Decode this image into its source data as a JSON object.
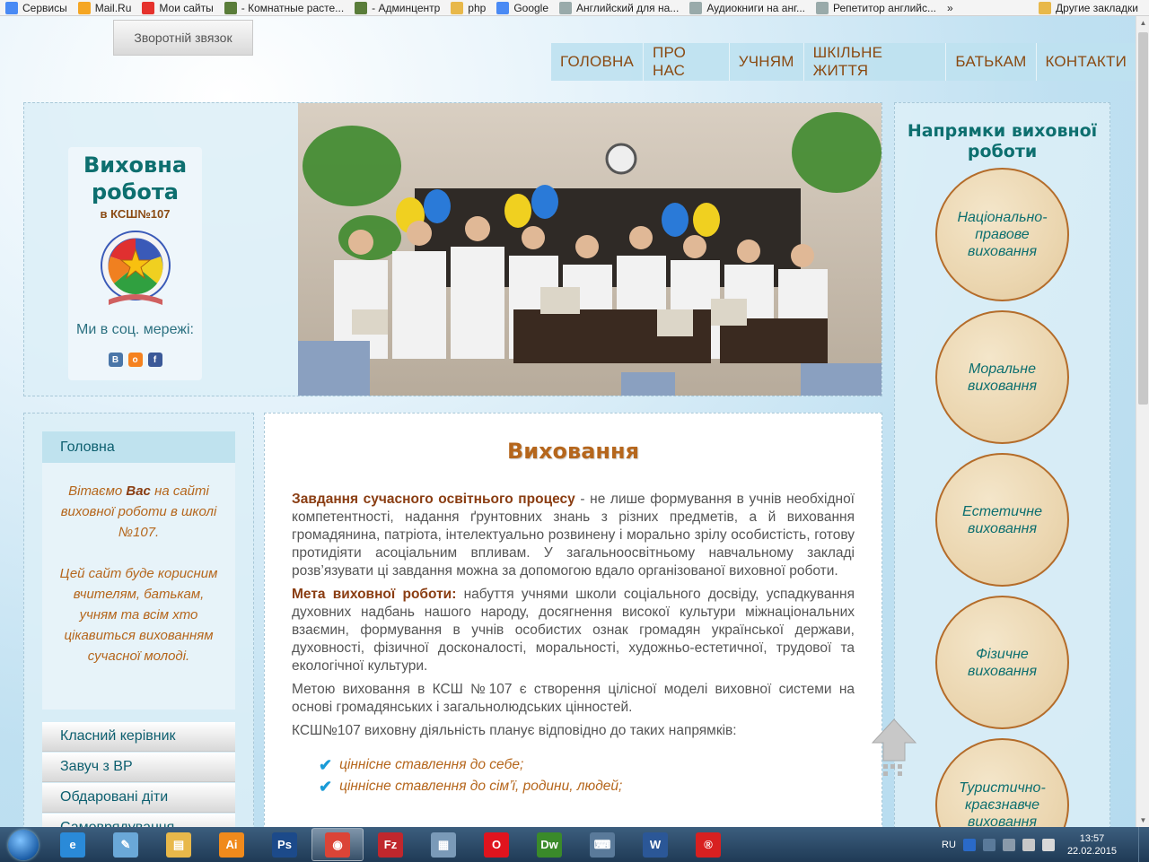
{
  "bookmarks": [
    {
      "label": "Сервисы",
      "icon": "apps-icon",
      "color": "#4a8af4"
    },
    {
      "label": "Mail.Ru",
      "icon": "mailru-icon",
      "color": "#f5a623"
    },
    {
      "label": "Мои сайты",
      "icon": "ua-icon",
      "color": "#e5322d"
    },
    {
      "label": "- Комнатные расте...",
      "icon": "plant-icon",
      "color": "#5a7d3a"
    },
    {
      "label": "- Админцентр",
      "icon": "plant-icon",
      "color": "#5a7d3a"
    },
    {
      "label": "php",
      "icon": "folder-icon",
      "color": "#e8b84a"
    },
    {
      "label": "Google",
      "icon": "google-icon",
      "color": "#4a8af4"
    },
    {
      "label": "Английский для на...",
      "icon": "page-icon",
      "color": "#9aa"
    },
    {
      "label": "Аудиокниги на анг...",
      "icon": "page-icon",
      "color": "#9aa"
    },
    {
      "label": "Репетитор английс...",
      "icon": "page-icon",
      "color": "#9aa"
    }
  ],
  "bookmarks_more": "»",
  "bookmarks_other": "Другие закладки",
  "feedback_label": "Зворотній звязок",
  "nav": [
    "ГОЛОВНА",
    "ПРО НАС",
    "УЧНЯМ",
    "ШКІЛЬНЕ ЖИТТЯ",
    "БАТЬКАМ",
    "КОНТАКТИ"
  ],
  "logo": {
    "title": "Виховна робота",
    "subtitle": "в КСШ№107",
    "social_label": "Ми в соц. мережі:",
    "social": [
      {
        "name": "vk-icon",
        "glyph": "В",
        "color": "#4a76a8"
      },
      {
        "name": "odnoklassniki-icon",
        "glyph": "о",
        "color": "#f5821f"
      },
      {
        "name": "facebook-icon",
        "glyph": "f",
        "color": "#3b5998"
      }
    ]
  },
  "right": {
    "title": "Напрямки виховної роботи",
    "circles": [
      "Національно-правове виховання",
      "Моральне виховання",
      "Естетичне виховання",
      "Фізичне виховання",
      "Туристично-краєзнавче виховання"
    ]
  },
  "left": {
    "active": "Головна",
    "welcome_p1_a": "Вітаємо ",
    "welcome_p1_b": "Вас",
    "welcome_p1_c": " на сайті виховної роботи в школі №107.",
    "welcome_p2": "Цей сайт буде корисним вчителям, батькам, учням та всім хто цікавиться вихованням сучасної молоді.",
    "menu": [
      "Класний керівник",
      "Завуч з ВР",
      "Обдаровані діти",
      "Самоврядування"
    ]
  },
  "content": {
    "title": "Виховання",
    "p1_bold": "Завдання сучасного освітнього процесу",
    "p1_text": " - не лише формування в учнів необхідної компетентності, надання  ґрунтовних знань з різних предметів, а й виховання громадянина, патріота, інтелектуально розвинену  і морально зрілу особистість, готову протидіяти асоціальним впливам. У загальноосвітньому навчальному закладі розв’язувати ці завдання можна за допомогою вдало організованої виховної роботи.",
    "p2_bold": "Мета виховної роботи:",
    "p2_text": " набуття учнями школи соціального досвіду, успадкування духовних надбань нашого народу, досягнення високої культури міжнаціональних взаємин, формування в учнів особистих ознак громадян української держави, духовності, фізичної досконалості, моральності, художньо-естетичної, трудової та екологічної культури.",
    "p3": "Метою виховання в КСШ №107 є створення цілісної моделі виховної системи на основі громадянських і загальнолюдських цінностей.",
    "p4": "КСШ№107 виховну діяльність планує відповідно до таких напрямків:",
    "list": [
      "ціннісне ставлення до себе;",
      "ціннісне ставлення до сім’ї, родини, людей;"
    ]
  },
  "taskbar": {
    "apps": [
      {
        "name": "ie-icon",
        "glyph": "e",
        "color": "#2a8ad8"
      },
      {
        "name": "notes-icon",
        "glyph": "✎",
        "color": "#6aa8d8"
      },
      {
        "name": "explorer-icon",
        "glyph": "▤",
        "color": "#e8b84a"
      },
      {
        "name": "illustrator-icon",
        "glyph": "Ai",
        "color": "#f08a1c"
      },
      {
        "name": "photoshop-icon",
        "glyph": "Ps",
        "color": "#1c4a8a"
      },
      {
        "name": "chrome-icon",
        "glyph": "◉",
        "color": "#db4437"
      },
      {
        "name": "filezilla-icon",
        "glyph": "Fz",
        "color": "#c0272d"
      },
      {
        "name": "calculator-icon",
        "glyph": "▦",
        "color": "#7a9ab8"
      },
      {
        "name": "opera-icon",
        "glyph": "O",
        "color": "#e0141e"
      },
      {
        "name": "dreamweaver-icon",
        "glyph": "Dw",
        "color": "#3a8a2a"
      },
      {
        "name": "keyboard-icon",
        "glyph": "⌨",
        "color": "#5a7a9a"
      },
      {
        "name": "word-icon",
        "glyph": "W",
        "color": "#2b5797"
      },
      {
        "name": "app-red-icon",
        "glyph": "®",
        "color": "#d82020"
      }
    ],
    "active_index": 5,
    "lang": "RU",
    "time": "13:57",
    "date": "22.02.2015"
  }
}
